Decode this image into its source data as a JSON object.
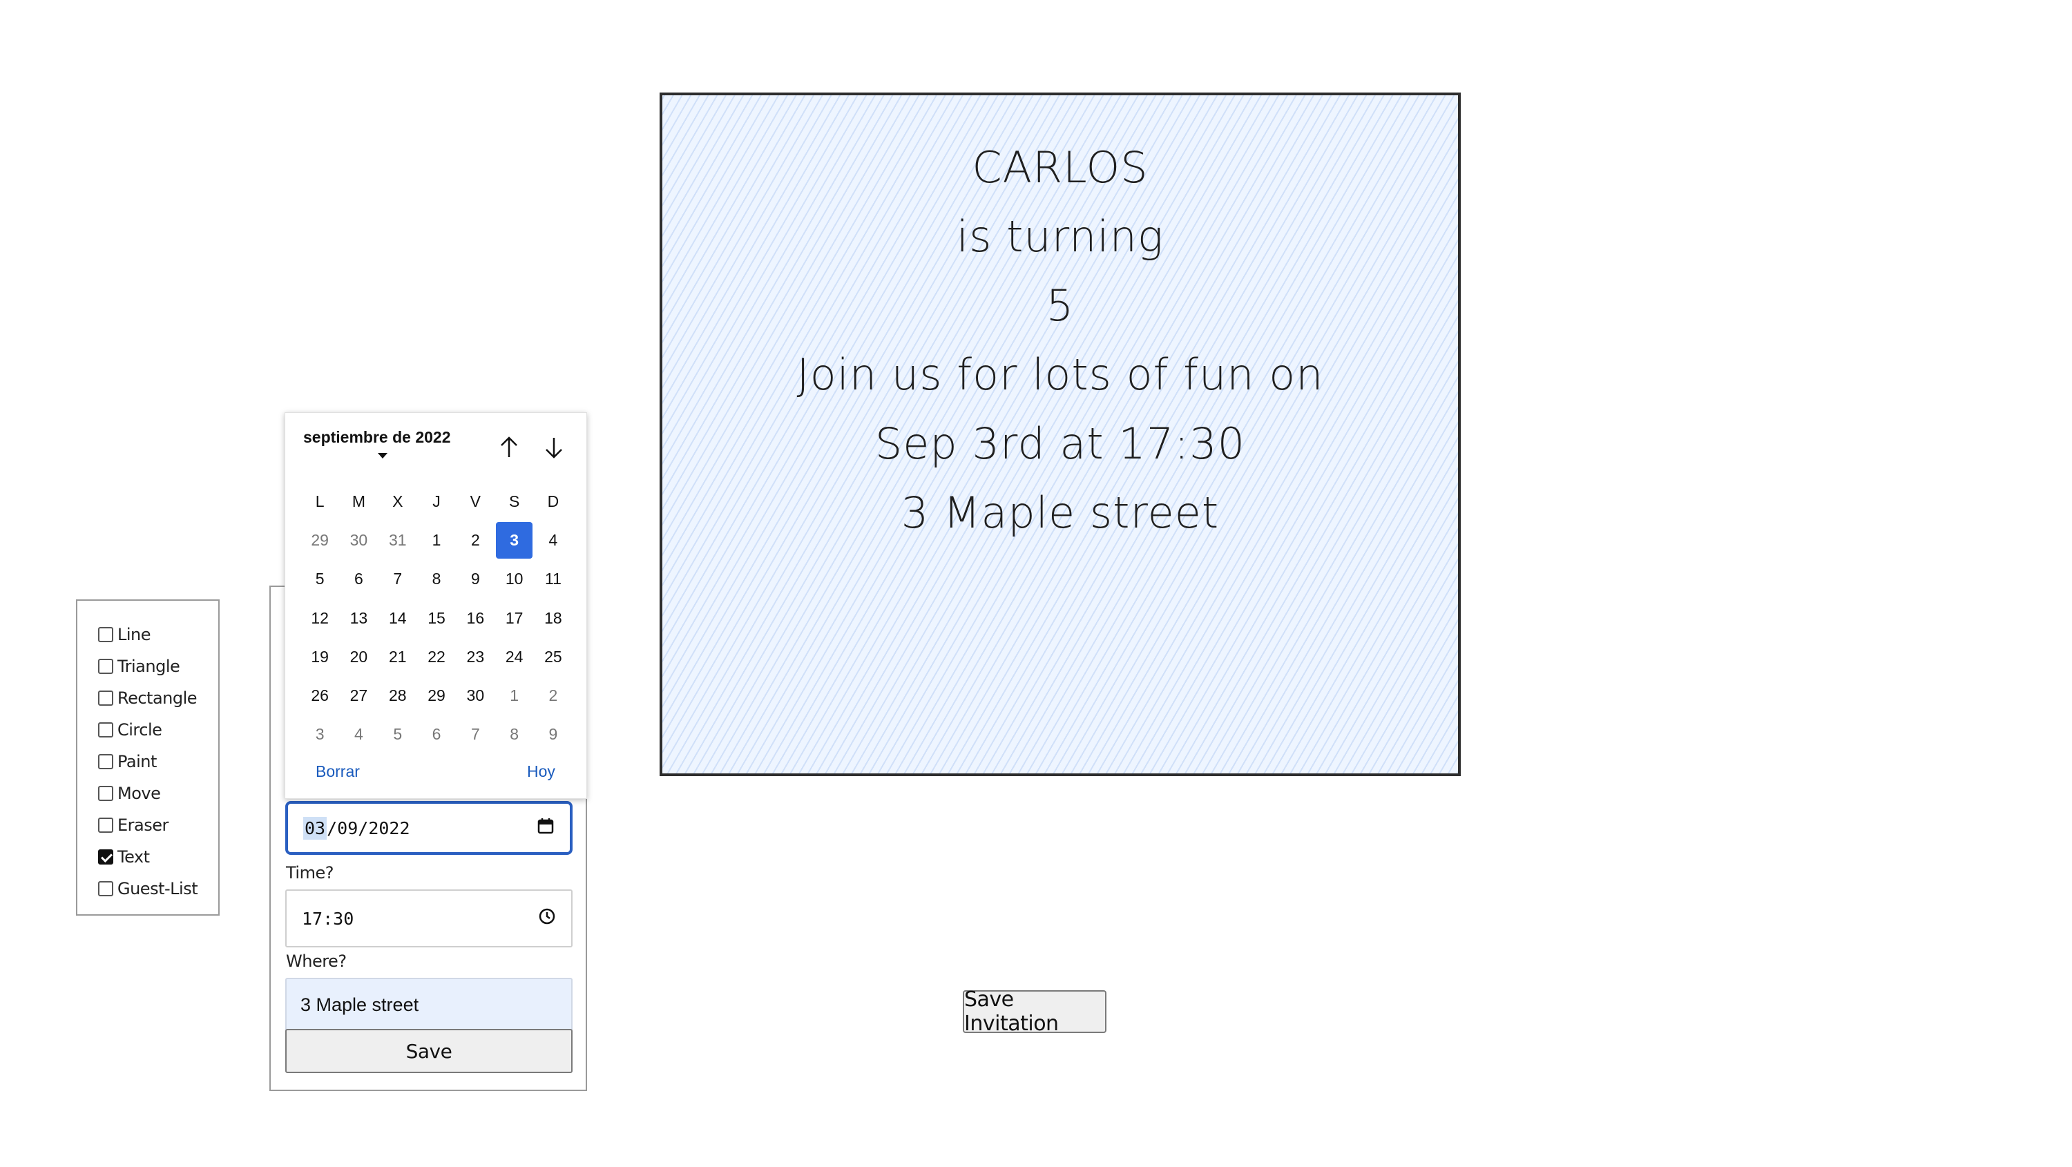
{
  "invitation": {
    "lines": [
      "CARLOS",
      "is turning",
      "5",
      "Join us for lots of fun on",
      "Sep 3rd at 17:30",
      "3 Maple street"
    ]
  },
  "tools": [
    {
      "label": "Line",
      "checked": false
    },
    {
      "label": "Triangle",
      "checked": false
    },
    {
      "label": "Rectangle",
      "checked": false
    },
    {
      "label": "Circle",
      "checked": false
    },
    {
      "label": "Paint",
      "checked": false
    },
    {
      "label": "Move",
      "checked": false
    },
    {
      "label": "Eraser",
      "checked": false
    },
    {
      "label": "Text",
      "checked": true
    },
    {
      "label": "Guest-List",
      "checked": false
    }
  ],
  "form": {
    "date": {
      "day": "03",
      "rest": "/09/2022"
    },
    "time_label": "Time?",
    "time": "17:30",
    "where_label": "Where?",
    "where_value": "3 Maple street",
    "save_label": "Save"
  },
  "datepicker": {
    "month_label": "septiembre de 2022",
    "weekdays": [
      "L",
      "M",
      "X",
      "J",
      "V",
      "S",
      "D"
    ],
    "days": [
      [
        "29",
        "30",
        "31",
        "1",
        "2",
        "3",
        "4"
      ],
      [
        "5",
        "6",
        "7",
        "8",
        "9",
        "10",
        "11"
      ],
      [
        "12",
        "13",
        "14",
        "15",
        "16",
        "17",
        "18"
      ],
      [
        "19",
        "20",
        "21",
        "22",
        "23",
        "24",
        "25"
      ],
      [
        "26",
        "27",
        "28",
        "29",
        "30",
        "1",
        "2"
      ],
      [
        "3",
        "4",
        "5",
        "6",
        "7",
        "8",
        "9"
      ]
    ],
    "muted": [
      [
        true,
        true,
        true,
        false,
        false,
        false,
        false
      ],
      [
        false,
        false,
        false,
        false,
        false,
        false,
        false
      ],
      [
        false,
        false,
        false,
        false,
        false,
        false,
        false
      ],
      [
        false,
        false,
        false,
        false,
        false,
        false,
        false
      ],
      [
        false,
        false,
        false,
        false,
        false,
        true,
        true
      ],
      [
        true,
        true,
        true,
        true,
        true,
        true,
        true
      ]
    ],
    "selected": "3",
    "clear_label": "Borrar",
    "today_label": "Hoy"
  },
  "save_invitation_label": "Save Invitation",
  "colors": {
    "accent": "#2f6be0",
    "link": "#1a5bbd",
    "canvas_bg": "#eef5ff"
  }
}
